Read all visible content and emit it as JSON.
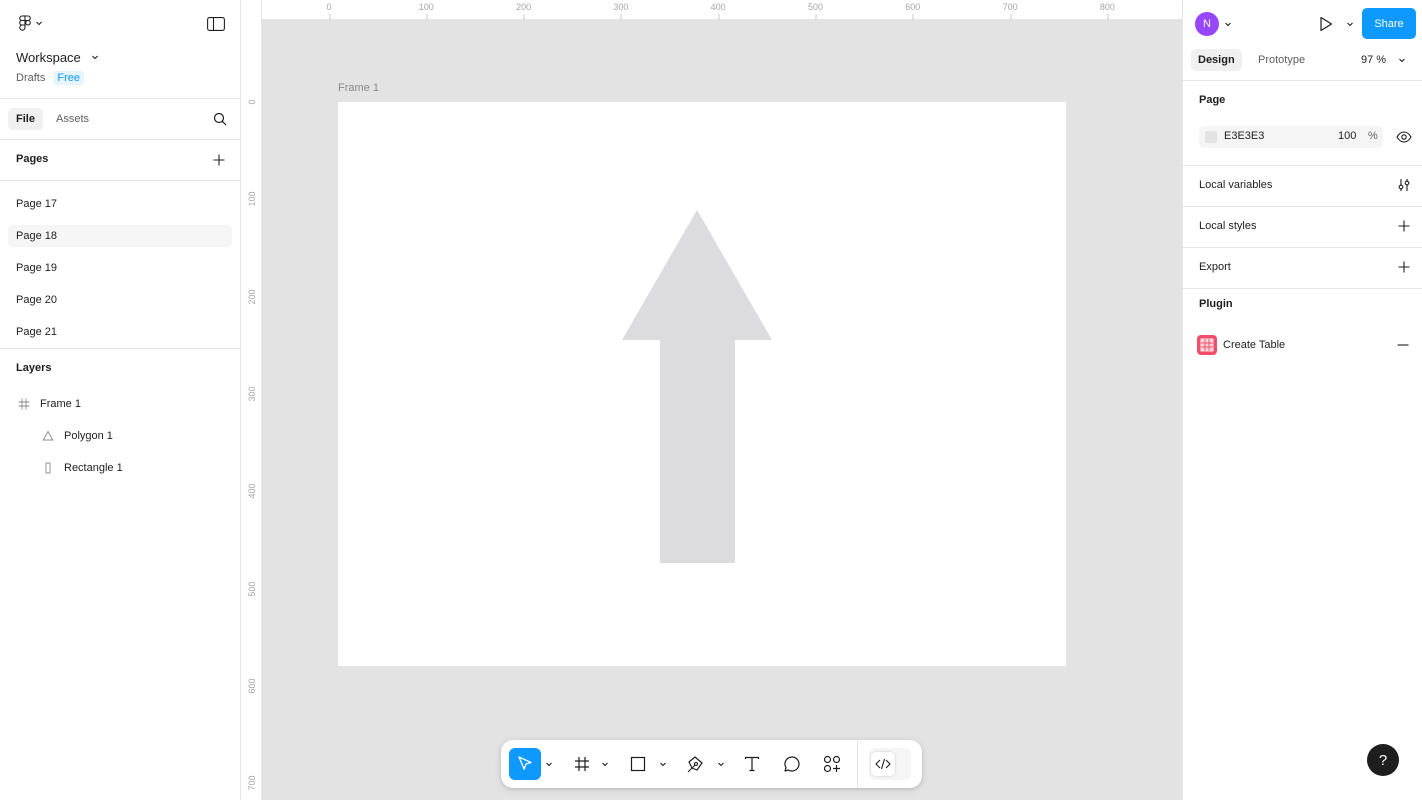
{
  "workspace": {
    "name": "Workspace",
    "drafts": "Drafts",
    "plan": "Free"
  },
  "panel_tabs": {
    "file": "File",
    "assets": "Assets"
  },
  "pages": {
    "title": "Pages",
    "items": [
      {
        "label": "Page 17",
        "selected": false
      },
      {
        "label": "Page 18",
        "selected": true
      },
      {
        "label": "Page 19",
        "selected": false
      },
      {
        "label": "Page 20",
        "selected": false
      },
      {
        "label": "Page 21",
        "selected": false
      }
    ]
  },
  "layers": {
    "title": "Layers",
    "items": [
      {
        "label": "Frame 1",
        "icon": "frame-icon"
      },
      {
        "label": "Polygon 1",
        "icon": "polygon-icon"
      },
      {
        "label": "Rectangle 1",
        "icon": "rectangle-icon"
      }
    ]
  },
  "canvas": {
    "frame_label": "Frame 1",
    "ruler_top": [
      "0",
      "100",
      "200",
      "300",
      "400",
      "500",
      "600",
      "700",
      "800"
    ],
    "ruler_left": [
      "0",
      "100",
      "200",
      "300",
      "400",
      "500",
      "600",
      "700"
    ],
    "background": "#e3e3e3",
    "shape_color": "#dcdbdd"
  },
  "header_right": {
    "avatar_initial": "N",
    "share": "Share"
  },
  "design_tabs": {
    "design": "Design",
    "prototype": "Prototype",
    "zoom": "97 %"
  },
  "page_section": {
    "title": "Page",
    "color_hex": "E3E3E3",
    "opacity": "100",
    "percent": "%"
  },
  "sections": {
    "local_variables": "Local variables",
    "local_styles": "Local styles",
    "export": "Export",
    "plugin": "Plugin"
  },
  "plugin_item": {
    "label": "Create Table"
  },
  "help": "?",
  "colors": {
    "accent": "#0d99ff",
    "avatar": "#9747ff",
    "plugin": "#f24e6b"
  }
}
